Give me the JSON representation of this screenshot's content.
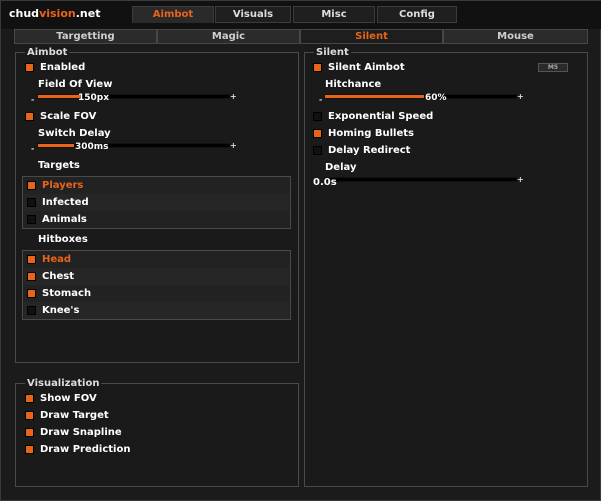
{
  "logo": {
    "prefix": "chud",
    "accent": "vision",
    "suffix": ".net"
  },
  "tabs": [
    {
      "label": "Aimbot",
      "active": true
    },
    {
      "label": "Visuals",
      "active": false
    },
    {
      "label": "Misc",
      "active": false
    },
    {
      "label": "Config",
      "active": false
    }
  ],
  "subtabs": [
    {
      "label": "Targetting",
      "active": false
    },
    {
      "label": "Magic",
      "active": false
    },
    {
      "label": "Silent",
      "active": true
    },
    {
      "label": "Mouse",
      "active": false
    }
  ],
  "aimbot": {
    "title": "Aimbot",
    "enabled": {
      "label": "Enabled",
      "checked": true
    },
    "fov": {
      "label": "Field Of View",
      "value": "150px",
      "fraction": 0.22
    },
    "scale_fov": {
      "label": "Scale FOV",
      "checked": true
    },
    "switch_delay": {
      "label": "Switch Delay",
      "value": "300ms",
      "fraction": 0.19
    },
    "targets_label": "Targets",
    "targets": [
      {
        "label": "Players",
        "checked": true
      },
      {
        "label": "Infected",
        "checked": false
      },
      {
        "label": "Animals",
        "checked": false
      }
    ],
    "hitboxes_label": "Hitboxes",
    "hitboxes": [
      {
        "label": "Head",
        "checked": true
      },
      {
        "label": "Chest",
        "checked": true
      },
      {
        "label": "Stomach",
        "checked": true
      },
      {
        "label": "Knee's",
        "checked": false
      }
    ],
    "slider_min": "-",
    "slider_max": "+"
  },
  "visualization": {
    "title": "Visualization",
    "items": [
      {
        "label": "Show FOV",
        "checked": true
      },
      {
        "label": "Draw Target",
        "checked": true
      },
      {
        "label": "Draw Snapline",
        "checked": true
      },
      {
        "label": "Draw Prediction",
        "checked": true
      }
    ]
  },
  "silent": {
    "title": "Silent",
    "silent_aimbot": {
      "label": "Silent Aimbot",
      "checked": true,
      "key": "M5"
    },
    "hitchance": {
      "label": "Hitchance",
      "value": "60%",
      "fraction": 0.52
    },
    "exponential_speed": {
      "label": "Exponential Speed",
      "checked": false
    },
    "homing_bullets": {
      "label": "Homing Bullets",
      "checked": true
    },
    "delay_redirect": {
      "label": "Delay Redirect",
      "checked": false
    },
    "delay": {
      "label": "Delay",
      "value": "0.0s",
      "fraction": 0.0
    },
    "slider_min": "-",
    "slider_max": "+"
  },
  "colors": {
    "accent": "#e8641a",
    "bg": "#1b1b1b",
    "panel": "#1a1a1a"
  }
}
